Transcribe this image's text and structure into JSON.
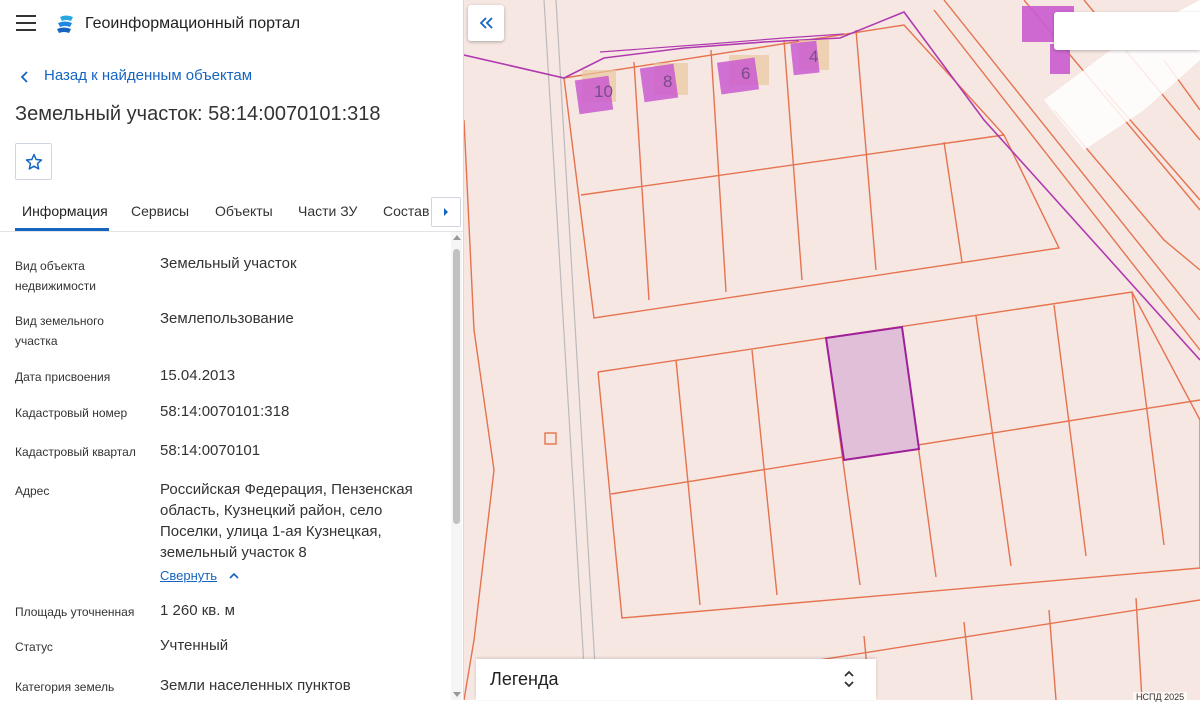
{
  "app": {
    "title": "Геоинформационный портал"
  },
  "nav": {
    "back_label": "Назад к найденным объектам"
  },
  "object": {
    "title": "Земельный участок: 58:14:0070101:318"
  },
  "tabs": [
    {
      "label": "Информация",
      "active": true
    },
    {
      "label": "Сервисы"
    },
    {
      "label": "Объекты"
    },
    {
      "label": "Части ЗУ"
    },
    {
      "label": "Состав"
    }
  ],
  "fields": [
    {
      "label": "Вид объекта недвижимости",
      "value": "Земельный участок"
    },
    {
      "label": "Вид земельного участка",
      "value": "Землепользование"
    },
    {
      "label": "Дата присвоения",
      "value": "15.04.2013"
    },
    {
      "label": "Кадастровый номер",
      "value": "58:14:0070101:318"
    },
    {
      "label": "Кадастровый квартал",
      "value": "58:14:0070101"
    },
    {
      "label": "Адрес",
      "value": "Российская Федерация, Пензенская область, Кузнецкий район, село Поселки, улица 1-ая Кузнецкая, земельный участок 8"
    },
    {
      "label": "Площадь уточненная",
      "value": "1 260 кв. м"
    },
    {
      "label": "Статус",
      "value": "Учтенный"
    },
    {
      "label": "Категория земель",
      "value": "Земли населенных пунктов"
    }
  ],
  "address_toggle": "Свернуть",
  "map": {
    "house_numbers": [
      "10",
      "8",
      "6",
      "4"
    ],
    "legend_label": "Легенда",
    "attribution": "НСПД 2025"
  },
  "colors": {
    "accent": "#1565c0",
    "parcel_line": "#e5734f",
    "selected_parcel": "#a0209b",
    "map_bg": "#f7e7e2"
  },
  "icons": {
    "menu": "hamburger-icon",
    "logo": "portal-logo-icon",
    "back": "chevron-left-icon",
    "favorite": "star-outline-icon",
    "tabs_next": "caret-right-icon",
    "panel_toggle": "double-chevron-left-icon",
    "legend_toggle": "chevron-updown-icon"
  }
}
